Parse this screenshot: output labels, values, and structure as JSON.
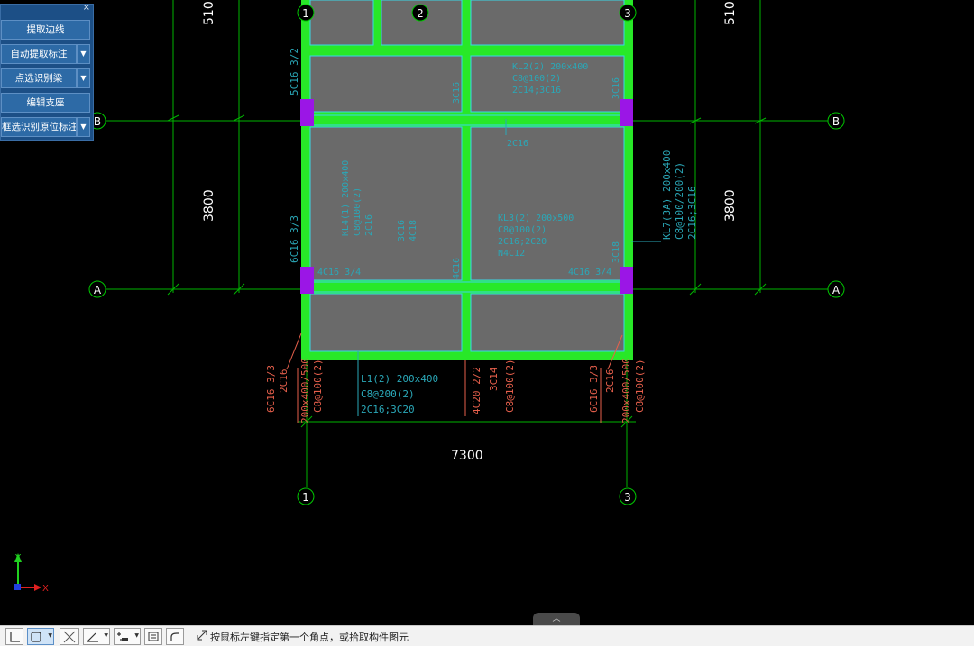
{
  "panel": {
    "close": "×",
    "buttons": [
      {
        "label": "提取边线",
        "has_dropdown": false
      },
      {
        "label": "自动提取标注",
        "has_dropdown": true
      },
      {
        "label": "点选识别梁",
        "has_dropdown": true
      },
      {
        "label": "编辑支座",
        "has_dropdown": false
      },
      {
        "label": "框选识别原位标注",
        "has_dropdown": true
      }
    ]
  },
  "drawing": {
    "axis_bubbles": {
      "c1": "1",
      "c2": "2",
      "c3": "3",
      "rA": "A",
      "rB": "B"
    },
    "dims": {
      "top_left": "510",
      "top_right": "510",
      "mid_left": "3800",
      "mid_right": "3800",
      "bottom": "7300"
    },
    "annotations": {
      "col_left_top": "5C16 3/2",
      "col_left_mid": "6C16 3/3",
      "right_beam_1": "KL7(3A) 200x400",
      "right_beam_2": "C8@100/200(2)",
      "right_beam_3": "2C16;3C16",
      "bottom_left_1": "6C16 3/3",
      "bottom_left_2": "2C16",
      "bottom_left_3": "200x400/500",
      "bottom_left_4": "C8@100(2)",
      "l1_1": "L1(2) 200x400",
      "l1_2": "C8@200(2)",
      "l1_3": "2C16;3C20",
      "bottom_mid_1": "4C20 2/2",
      "bottom_mid_2": "3C14",
      "bottom_mid_3": "C8@100(2)",
      "bottom_right_1": "6C16 3/3",
      "bottom_right_2": "2C16",
      "bottom_right_3": "200x400/500",
      "bottom_right_4": "C8@100(2)",
      "inner_1": "KL2(2) 200x400",
      "inner_2": "C8@100(2)",
      "inner_3": "2C14;3C16",
      "inner_4": "2C16",
      "inner_5": "KL3(2) 200x500",
      "inner_6": "C8@100(2)",
      "inner_7": "2C16;2C20",
      "inner_8": "N4C12",
      "inner_9": "KL4(1) 200x400",
      "inner_10": "C8@100(2)",
      "inner_11": "2C16",
      "inner_12": "4C16 3/4",
      "inner_13": "4C16 3/4",
      "inner_14": "3C16",
      "inner_15": "4C18",
      "inner_16": "3C16",
      "inner_17": "4C16",
      "inner_18": "3C16",
      "inner_19": "3C18"
    },
    "ucs": {
      "x": "X",
      "y": "Y"
    },
    "colors": {
      "slab": "#666666",
      "beam": "#28e828",
      "column": "#9b16e6",
      "axis": "#00c800",
      "text_beam": "#2aa8b8",
      "text_column": "#e8604c",
      "cyan_edge": "#3ad8e8"
    }
  },
  "statusbar": {
    "prompt": "按鼠标左键指定第一个角点，或拾取构件图元",
    "tools": [
      "ortho-icon",
      "select-box-icon",
      "snap-off-icon",
      "angle-icon",
      "dimension-icon",
      "property-icon",
      "arc-icon"
    ]
  },
  "tab_handle": "︿"
}
